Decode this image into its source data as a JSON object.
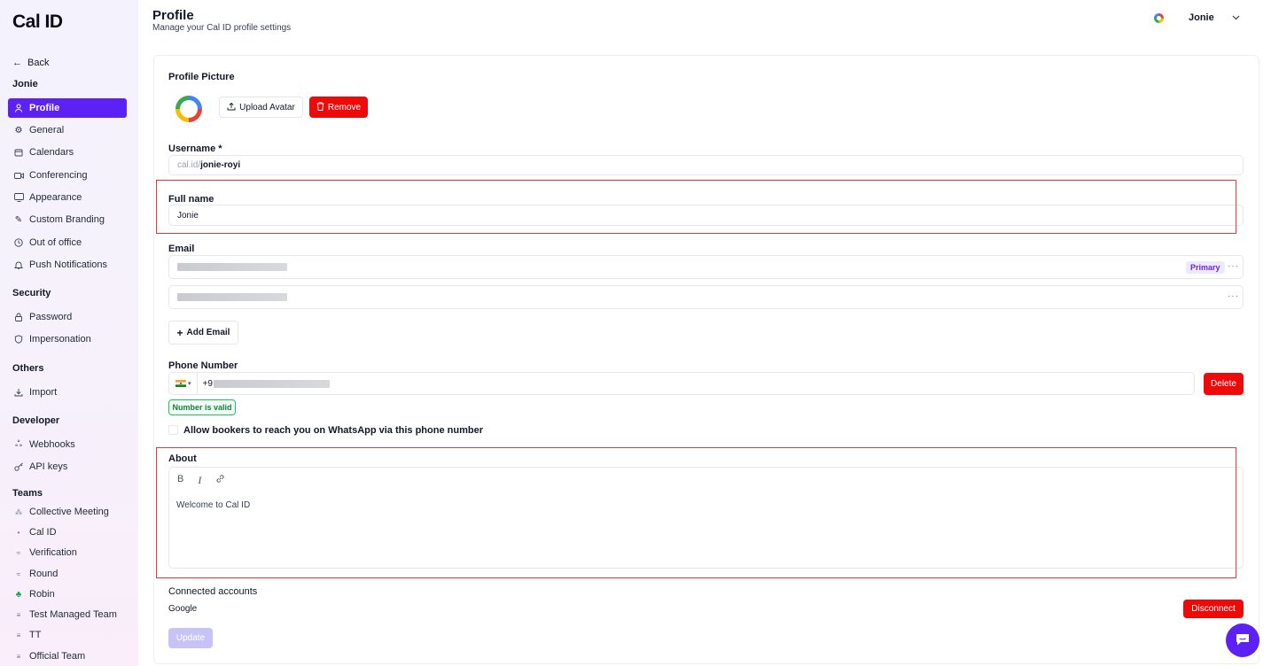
{
  "app": {
    "logo": "Cal ID"
  },
  "sidebar": {
    "back": "Back",
    "user_section": "Jonie",
    "items": [
      {
        "label": "Profile",
        "icon": "user-icon",
        "active": true
      },
      {
        "label": "General",
        "icon": "gear-icon"
      },
      {
        "label": "Calendars",
        "icon": "calendar-icon"
      },
      {
        "label": "Conferencing",
        "icon": "video-icon"
      },
      {
        "label": "Appearance",
        "icon": "monitor-icon"
      },
      {
        "label": "Custom Branding",
        "icon": "brush-icon"
      },
      {
        "label": "Out of office",
        "icon": "clock-icon"
      },
      {
        "label": "Push Notifications",
        "icon": "bell-icon"
      }
    ],
    "security_title": "Security",
    "security_items": [
      {
        "label": "Password",
        "icon": "lock-icon"
      },
      {
        "label": "Impersonation",
        "icon": "shield-icon"
      }
    ],
    "others_title": "Others",
    "others_items": [
      {
        "label": "Import",
        "icon": "download-icon"
      }
    ],
    "developer_title": "Developer",
    "developer_items": [
      {
        "label": "Webhooks",
        "icon": "webhook-icon"
      },
      {
        "label": "API keys",
        "icon": "key-icon"
      }
    ],
    "teams_title": "Teams",
    "teams": [
      {
        "label": "Collective Meeting"
      },
      {
        "label": "Cal ID"
      },
      {
        "label": "Verification"
      },
      {
        "label": "Round"
      },
      {
        "label": "Robin"
      },
      {
        "label": "Test Managed Team"
      },
      {
        "label": "TT"
      },
      {
        "label": "Official Team"
      }
    ]
  },
  "header": {
    "title": "Profile",
    "subtitle": "Manage your Cal ID profile settings",
    "user_name": "Jonie"
  },
  "profile": {
    "picture_label": "Profile Picture",
    "upload_label": "Upload Avatar",
    "remove_label": "Remove",
    "username_label": "Username *",
    "username_prefix": "cal.id/",
    "username_value": "jonie-royi",
    "fullname_label": "Full name",
    "fullname_value": "Jonie",
    "email_label": "Email",
    "primary_badge": "Primary",
    "email_more": "···",
    "add_email_label": "Add Email",
    "phone_label": "Phone Number",
    "phone_prefix": "+9",
    "delete_label": "Delete",
    "valid_label": "Number is valid",
    "whatsapp_label": "Allow bookers to reach you on WhatsApp via this phone number",
    "about_label": "About",
    "about_text": "Welcome to Cal ID",
    "connected_label": "Connected accounts",
    "connected_provider": "Google",
    "disconnect_label": "Disconnect",
    "update_label": "Update"
  },
  "colors": {
    "accent": "#5b21f5",
    "danger": "#ef0a0a",
    "highlight": "#e03a3a"
  }
}
